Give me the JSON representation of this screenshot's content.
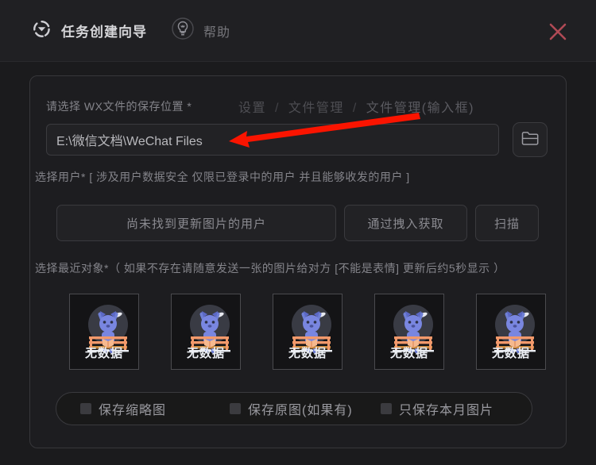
{
  "window": {
    "title": "任务创建向导",
    "title_icon": "target-crosshair-icon",
    "help_label": "帮助",
    "help_icon": "lightbulb-icon",
    "close_icon": "close-x-icon",
    "close_color": "#b04a55"
  },
  "form": {
    "path_section": {
      "label": "请选择 WX文件的保存位置 *",
      "breadcrumb": {
        "items": [
          "设置",
          "文件管理",
          "文件管理(输入框)"
        ],
        "separator": "/"
      },
      "input_value": "E:\\微信文档\\WeChat Files",
      "input_placeholder": "E:\\微信文档\\WeChat Files",
      "browse_icon": "folder-icon"
    },
    "user_section": {
      "label": "选择用户*  [ 涉及用户数据安全  仅限已登录中的用户 并且能够收发的用户 ]",
      "buttons": [
        {
          "label": "尚未找到更新图片的用户",
          "name": "no-updated-image-users-button"
        },
        {
          "label": "通过拽入获取",
          "name": "get-by-drag-button"
        },
        {
          "label": "扫描",
          "name": "scan-button"
        }
      ]
    },
    "recent_section": {
      "label": "选择最近对象*（ 如果不存在请随意发送一张的图片给对方 [不能是表情] 更新后约5秒显示 ）",
      "thumbnails": [
        {
          "label": "无数据"
        },
        {
          "label": "无数据"
        },
        {
          "label": "无数据"
        },
        {
          "label": "无数据"
        },
        {
          "label": "无数据"
        }
      ]
    },
    "options": [
      {
        "label": "保存缩略图",
        "checked": false,
        "name": "save-thumbnail-checkbox"
      },
      {
        "label": "保存原图(如果有)",
        "checked": false,
        "name": "save-original-checkbox"
      },
      {
        "label": "只保存本月图片",
        "checked": false,
        "name": "save-this-month-only-checkbox"
      }
    ]
  },
  "annotation": {
    "arrow_color": "#fa1400",
    "arrow_name": "red-pointer-arrow"
  }
}
